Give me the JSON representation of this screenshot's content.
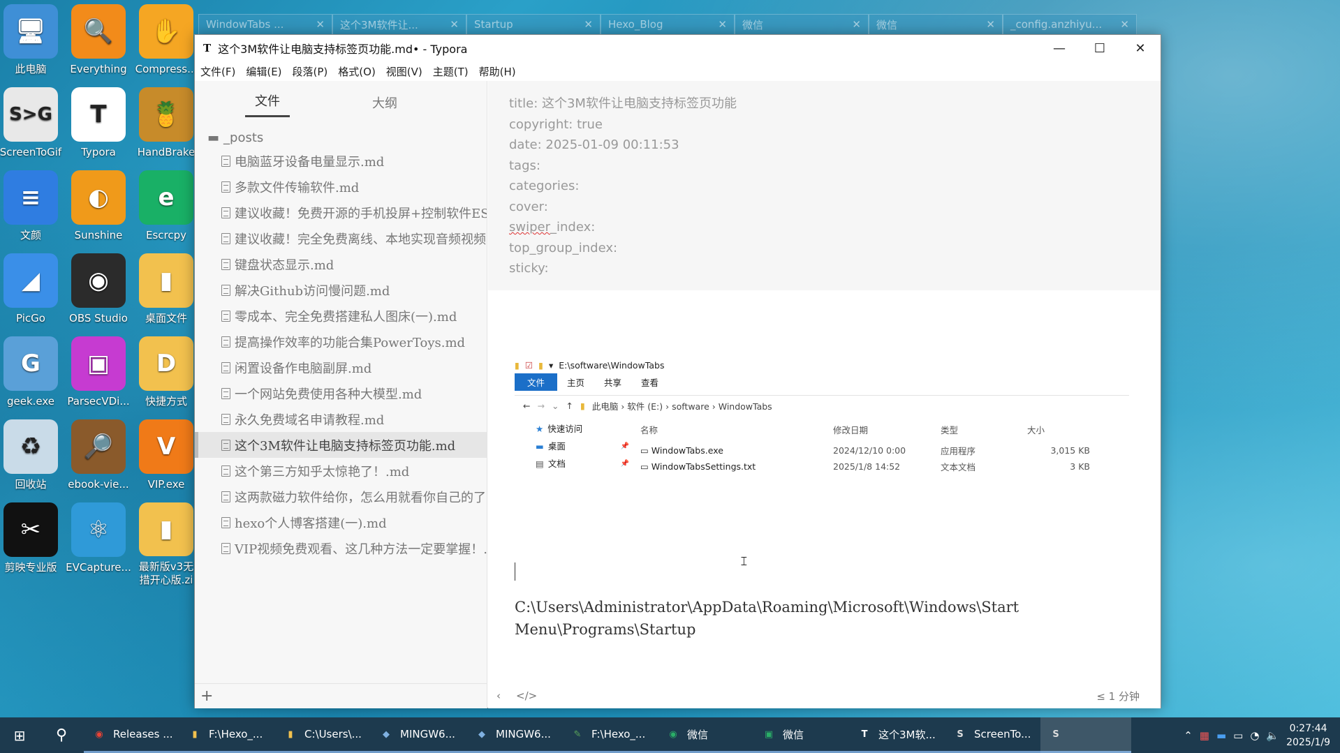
{
  "desktop": {
    "icons": [
      {
        "label": "此电脑",
        "glyph": "🖥",
        "bg": "#3f8fd6"
      },
      {
        "label": "Everything",
        "glyph": "🔍",
        "bg": "#f28b1a"
      },
      {
        "label": "Compress...",
        "glyph": "✋",
        "bg": "#f5a623"
      },
      {
        "label": "ScreenToGif",
        "glyph": "S>G",
        "bg": "#e8e8e8"
      },
      {
        "label": "Typora",
        "glyph": "T",
        "bg": "#ffffff"
      },
      {
        "label": "HandBrake",
        "glyph": "🍍",
        "bg": "#c78b2a"
      },
      {
        "label": "文颜",
        "glyph": "≡",
        "bg": "#2f7de1"
      },
      {
        "label": "Sunshine",
        "glyph": "◐",
        "bg": "#f09a1a"
      },
      {
        "label": "Escrcpy",
        "glyph": "e",
        "bg": "#19b066"
      },
      {
        "label": "PicGo",
        "glyph": "◢",
        "bg": "#3a8fe8"
      },
      {
        "label": "OBS Studio",
        "glyph": "◉",
        "bg": "#2b2b2b"
      },
      {
        "label": "桌面文件",
        "glyph": "▮",
        "bg": "#f2c14e"
      },
      {
        "label": "geek.exe",
        "glyph": "G",
        "bg": "#5aa0d8"
      },
      {
        "label": "ParsecVDi...",
        "glyph": "▣",
        "bg": "#c63bd1"
      },
      {
        "label": "快捷方式",
        "glyph": "D",
        "bg": "#f2c14e"
      },
      {
        "label": "回收站",
        "glyph": "♻",
        "bg": "#c9dbe8"
      },
      {
        "label": "ebook-vie...",
        "glyph": "🔎",
        "bg": "#8a5a2b"
      },
      {
        "label": "VIP.exe",
        "glyph": "V",
        "bg": "#f07a18"
      },
      {
        "label": "剪映专业版",
        "glyph": "✂",
        "bg": "#111111"
      },
      {
        "label": "EVCapture...",
        "glyph": "⚛",
        "bg": "#2f9ad8"
      },
      {
        "label": "最新版v3无\n措开心版.zi",
        "glyph": "▮",
        "bg": "#f2c14e"
      }
    ]
  },
  "bg_tabs": [
    {
      "label": "WindowTabs ..."
    },
    {
      "label": "这个3M软件让..."
    },
    {
      "label": "Startup"
    },
    {
      "label": "Hexo_Blog"
    },
    {
      "label": "微信"
    },
    {
      "label": "微信"
    },
    {
      "label": "_config.anzhiyu..."
    }
  ],
  "window": {
    "title": "这个3M软件让电脑支持标签页功能.md• - Typora",
    "app_icon": "T",
    "minimize": "—",
    "maximize": "☐",
    "close": "✕"
  },
  "menu": [
    "文件(F)",
    "编辑(E)",
    "段落(P)",
    "格式(O)",
    "视图(V)",
    "主题(T)",
    "帮助(H)"
  ],
  "sidebar": {
    "tab_files": "文件",
    "tab_outline": "大纲",
    "folder": "_posts",
    "files": [
      "电脑蓝牙设备电量显示.md",
      "多款文件传输软件.md",
      "建议收藏！免费开源的手机投屏+控制软件ES",
      "建议收藏！完全免费离线、本地实现音频视频",
      "键盘状态显示.md",
      "解决Github访问慢问题.md",
      "零成本、完全免费搭建私人图床(一).md",
      "提高操作效率的功能合集PowerToys.md",
      "闲置设备作电脑副屏.md",
      "一个网站免费使用各种大模型.md",
      "永久免费域名申请教程.md",
      "这个3M软件让电脑支持标签页功能.md",
      "这个第三方知乎太惊艳了！.md",
      "这两款磁力软件给你，怎么用就看你自己的了",
      "hexo个人博客搭建(一).md",
      "VIP视频免费观看、这几种方法一定要掌握！."
    ],
    "active_index": 11,
    "add_button": "+"
  },
  "front_matter": {
    "title": "title: 这个3M软件让电脑支持标签页功能",
    "copyright": "copyright: true",
    "date": "date: 2025-01-09 00:11:53",
    "tags": "tags:",
    "categories": "categories:",
    "cover": "cover:",
    "swiper_key": "swiper",
    "swiper_rest": "_index:",
    "top_group_index": "top_group_index:",
    "sticky": "sticky:"
  },
  "explorer": {
    "path": "E:\\software\\WindowTabs",
    "ribbon": [
      "文件",
      "主页",
      "共享",
      "查看"
    ],
    "breadcrumb": [
      "此电脑",
      "软件 (E:)",
      "software",
      "WindowTabs"
    ],
    "nav": [
      "快速访问",
      "桌面",
      "文档"
    ],
    "columns": [
      "名称",
      "修改日期",
      "类型",
      "大小"
    ],
    "rows": [
      {
        "name": "WindowTabs.exe",
        "date": "2024/12/10 0:00",
        "type": "应用程序",
        "size": "3,015 KB"
      },
      {
        "name": "WindowTabsSettings.txt",
        "date": "2025/1/8 14:52",
        "type": "文本文档",
        "size": "3 KB"
      }
    ]
  },
  "path_text_1": "C:\\Users\\Administrator\\AppData\\Roaming\\Microsoft\\Windows\\Start",
  "path_text_2": "Menu\\Programs\\Startup",
  "footer": {
    "back": "‹",
    "source_mode": "</>",
    "word_count": "≤ 1 分钟"
  },
  "taskbar": {
    "apps": [
      {
        "label": "Releases ...",
        "icon": "◉",
        "color": "#ea4335"
      },
      {
        "label": "F:\\Hexo_...",
        "icon": "▮",
        "color": "#f2c14e"
      },
      {
        "label": "C:\\Users\\...",
        "icon": "▮",
        "color": "#f2c14e"
      },
      {
        "label": "MINGW6...",
        "icon": "◆",
        "color": "#7fb0e0"
      },
      {
        "label": "MINGW6...",
        "icon": "◆",
        "color": "#7fb0e0"
      },
      {
        "label": "F:\\Hexo_...",
        "icon": "✎",
        "color": "#5aa45a"
      },
      {
        "label": "微信",
        "icon": "◉",
        "color": "#2aae67"
      },
      {
        "label": "微信",
        "icon": "▣",
        "color": "#2aae67"
      },
      {
        "label": "这个3M软...",
        "icon": "T",
        "color": "#ffffff"
      },
      {
        "label": "ScreenTo...",
        "icon": "S",
        "color": "#dddddd"
      },
      {
        "label": "",
        "icon": "S",
        "color": "#dddddd"
      }
    ],
    "time": "0:27:44",
    "date": "2025/1/9"
  }
}
